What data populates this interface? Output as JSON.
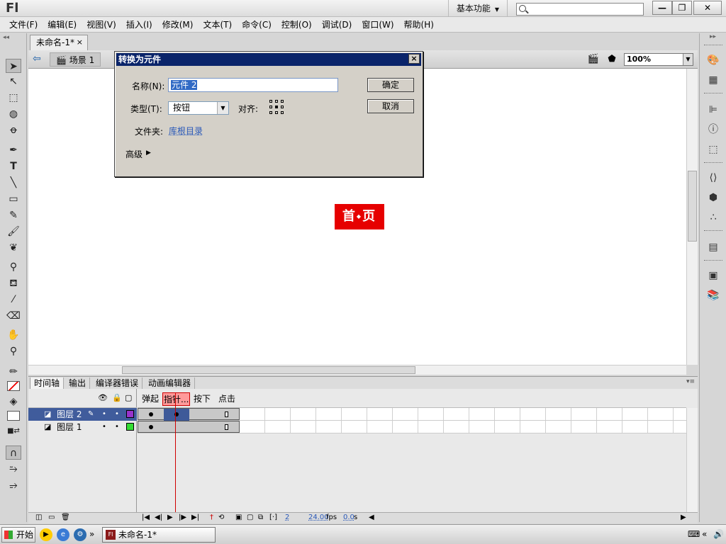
{
  "app": {
    "logo": "Fl",
    "workspace": "基本功能",
    "search_placeholder": ""
  },
  "menu": [
    "文件(F)",
    "编辑(E)",
    "视图(V)",
    "插入(I)",
    "修改(M)",
    "文本(T)",
    "命令(C)",
    "控制(O)",
    "调试(D)",
    "窗口(W)",
    "帮助(H)"
  ],
  "document": {
    "tab_label": "未命名-1*",
    "tab_close": "×",
    "scene": "场景 1",
    "zoom": "100%"
  },
  "stage": {
    "symbol_text_left": "首",
    "symbol_text_mid": "◆",
    "symbol_text_right": "页",
    "symbol_color": "#e60000"
  },
  "dialog": {
    "title": "转换为元件",
    "close": "×",
    "name_label": "名称(N):",
    "name_value": "元件 2",
    "type_label": "类型(T):",
    "type_value": "按钮",
    "align_label": "对齐:",
    "folder_label": "文件夹:",
    "folder_value": "库根目录",
    "advanced_label": "高级",
    "ok": "确定",
    "cancel": "取消"
  },
  "timeline": {
    "tabs": [
      "时间轴",
      "输出",
      "编译器错误",
      "动画编辑器"
    ],
    "frame_labels": [
      "弹起",
      "指针...",
      "按下",
      "点击"
    ],
    "layers": [
      {
        "name": "图层 2",
        "color": "#9933cc"
      },
      {
        "name": "图层 1",
        "color": "#33dd33"
      }
    ],
    "current_frame": "2",
    "fps": "24.00",
    "fps_unit": "fps",
    "time": "0.0",
    "time_unit": "s"
  },
  "taskbar": {
    "start": "开始",
    "task": "未命名-1*",
    "task_icon": "Fl"
  }
}
